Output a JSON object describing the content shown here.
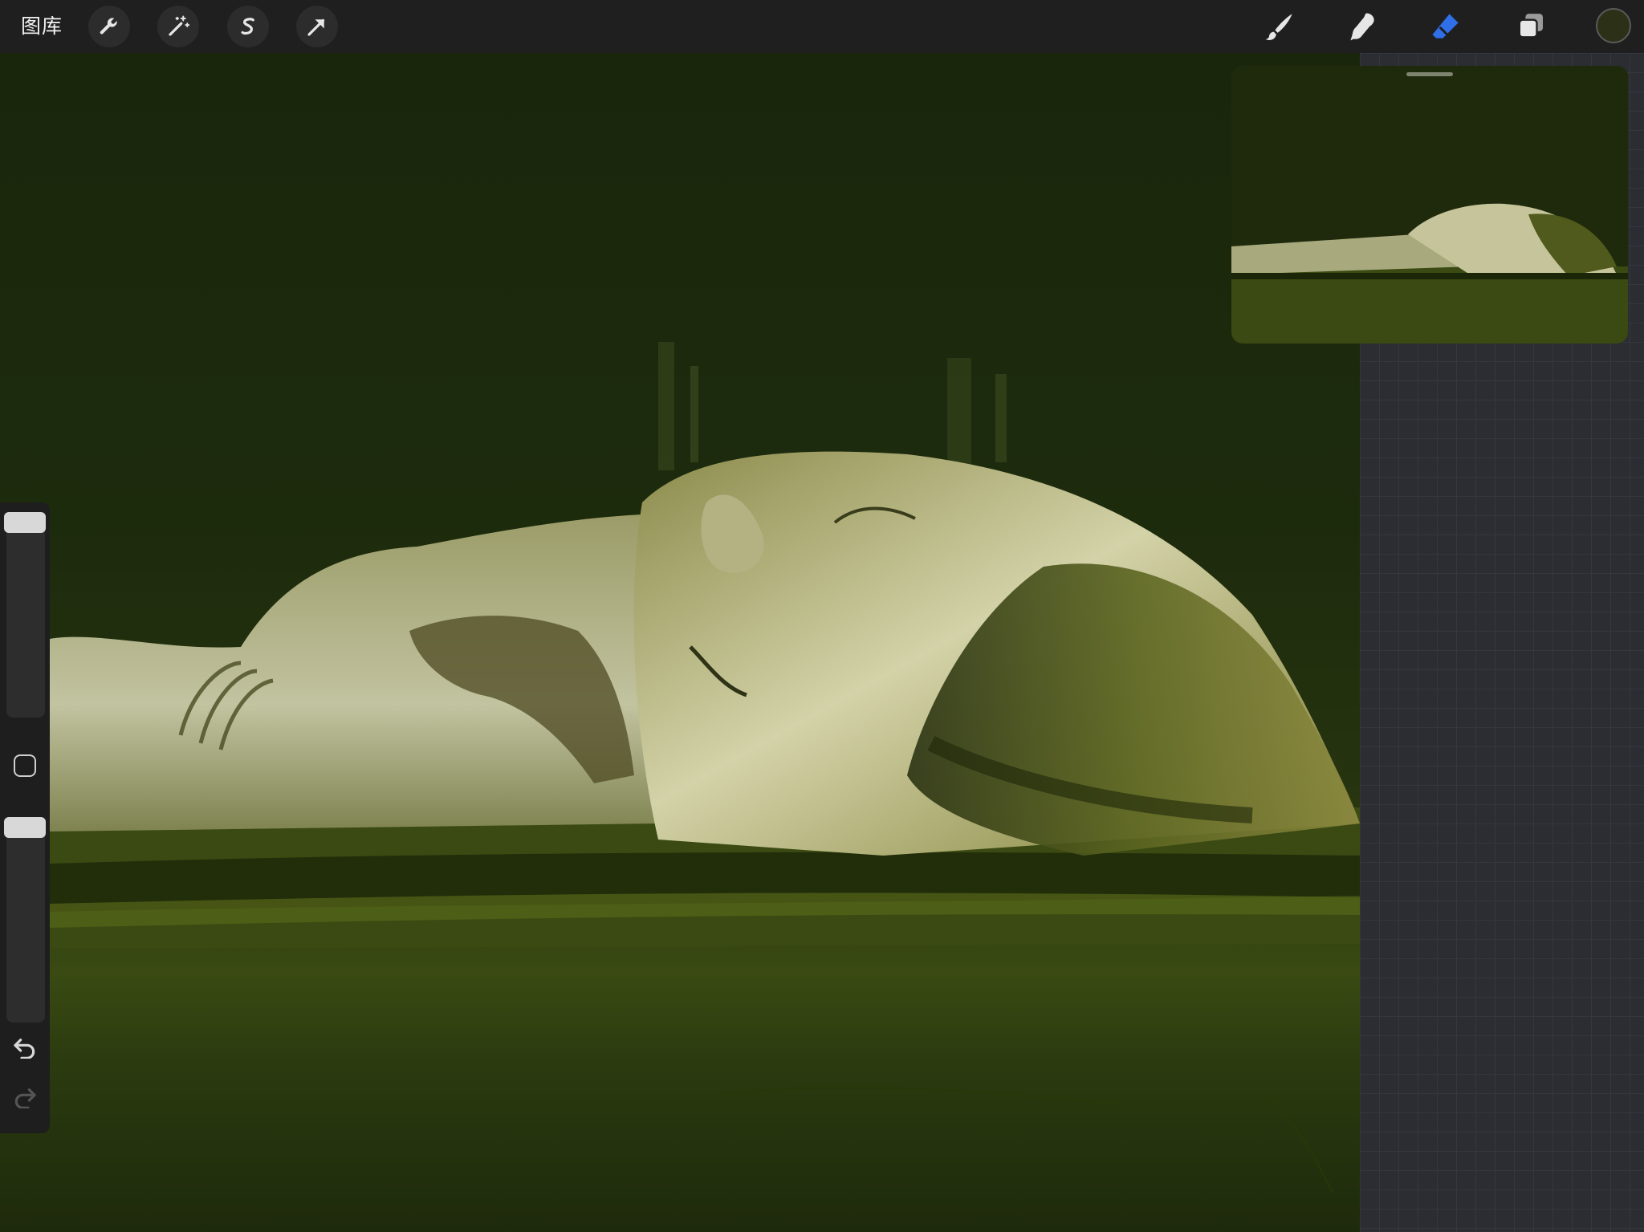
{
  "toolbar": {
    "gallery_label": "图库",
    "left_tools": [
      "wrench-icon",
      "magic-wand-icon",
      "selection-icon",
      "transform-arrow-icon"
    ],
    "right_tools": [
      "brush-icon",
      "smudge-icon",
      "eraser-icon",
      "layers-icon"
    ],
    "active_tool": "eraser",
    "active_color": "#2b3016",
    "accent_color": "#2f6fe8"
  },
  "sidebar": {
    "brush_size_level": 0.98,
    "opacity_level": 0.98
  }
}
